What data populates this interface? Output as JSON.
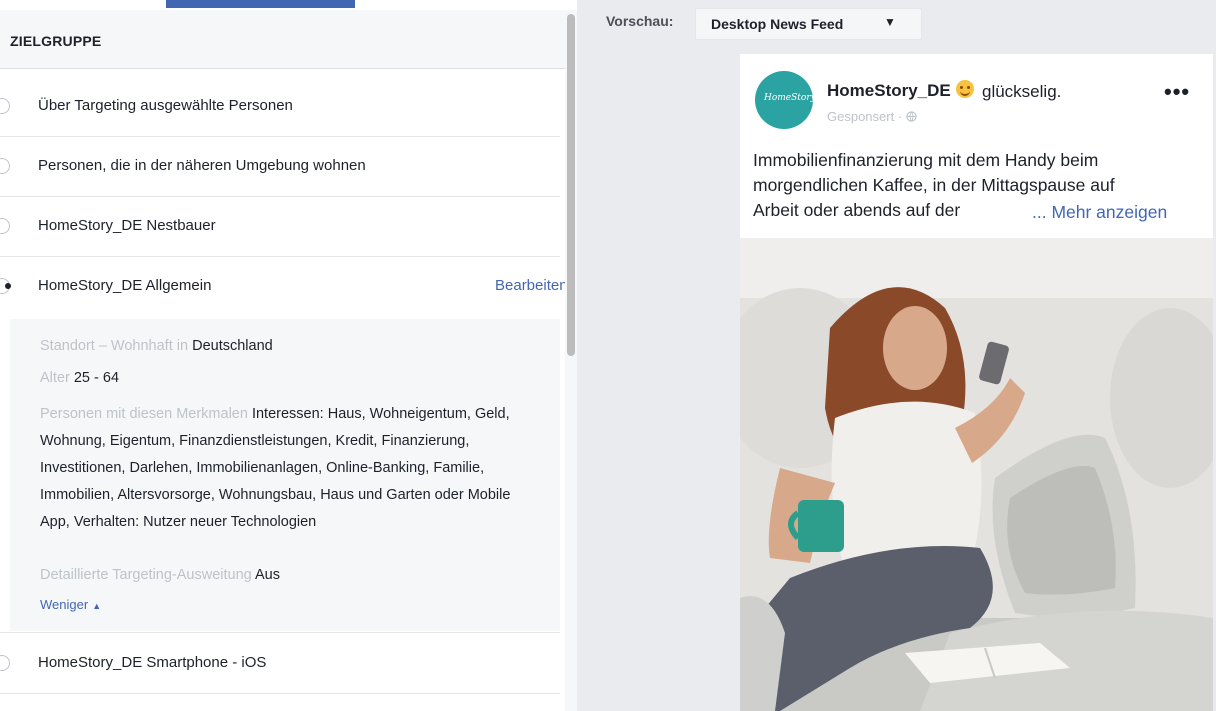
{
  "audience": {
    "title": "ZIELGRUPPE",
    "items": [
      {
        "label": "Über Targeting ausgewählte Personen"
      },
      {
        "label": "Personen, die in der näheren Umgebung wohnen"
      },
      {
        "label": "HomeStory_DE Nestbauer"
      },
      {
        "label": "HomeStory_DE Allgemein",
        "edit_label": "Bearbeiten"
      },
      {
        "label": "HomeStory_DE Smartphone - iOS"
      }
    ],
    "details": {
      "location_label": "Standort – Wohnhaft in",
      "location_value": "Deutschland",
      "age_label": "Alter",
      "age_value": "25 - 64",
      "traits_label": "Personen mit diesen Merkmalen",
      "traits_value": "Interessen: Haus, Wohneigentum, Geld, Wohnung, Eigentum, Finanzdienstleistungen, Kredit, Finanzierung, Investitionen, Darlehen, Immobilienanlagen, Online-Banking, Familie, Immobilien, Altersvorsorge, Wohnungsbau, Haus und Garten oder Mobile App, Verhalten: Nutzer neuer Technologien",
      "expansion_label": "Detaillierte Targeting-Ausweitung",
      "expansion_value": "Aus",
      "less_label": "Weniger"
    }
  },
  "preview": {
    "label": "Vorschau:",
    "placement": "Desktop News Feed"
  },
  "post": {
    "page_name": "HomeStory_DE",
    "feeling": "glückselig.",
    "sponsored": "Gesponsert · ",
    "avatar_text": "HomeStory",
    "more": "•••",
    "text_lines": [
      "Immobilienfinanzierung mit dem Handy beim",
      "morgendlichen Kaffee, in der Mittagspause auf",
      "Arbeit oder abends auf der"
    ],
    "see_more": "... Mehr anzeigen"
  },
  "colors": {
    "accent": "#4267b2",
    "avatar": "#2ba3a3",
    "muted": "#bec3c9"
  }
}
